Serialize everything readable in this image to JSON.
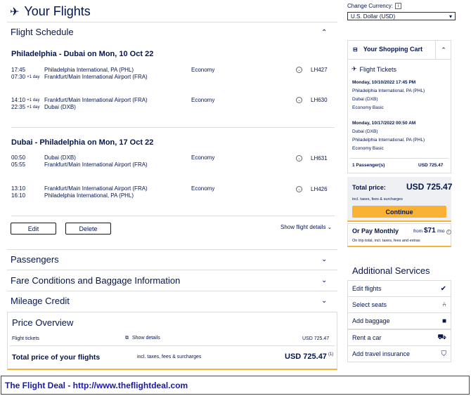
{
  "title": "Your Flights",
  "schedule": {
    "title": "Flight Schedule",
    "outbound": {
      "heading": "Philadelphia - Dubai on Mon, 10 Oct 22",
      "legs": [
        {
          "dep_time": "17:45",
          "arr_time": "07:30",
          "arr_sup": "+1 day",
          "from": "Philadelphia International, PA (PHL)",
          "to": "Frankfurt/Main International Airport (FRA)",
          "class": "Economy",
          "flight": "LH427"
        },
        {
          "dep_time": "14:10",
          "dep_sup": "+1 day",
          "arr_time": "22:35",
          "arr_sup": "+1 day",
          "from": "Frankfurt/Main International Airport (FRA)",
          "to": "Dubai (DXB)",
          "class": "Economy",
          "flight": "LH630"
        }
      ]
    },
    "inbound": {
      "heading": "Dubai - Philadelphia on Mon, 17 Oct 22",
      "legs": [
        {
          "dep_time": "00:50",
          "arr_time": "05:55",
          "from": "Dubai (DXB)",
          "to": "Frankfurt/Main International Airport (FRA)",
          "class": "Economy",
          "flight": "LH631"
        },
        {
          "dep_time": "13:10",
          "arr_time": "16:10",
          "from": "Frankfurt/Main International Airport (FRA)",
          "to": "Philadelphia International, PA (PHL)",
          "class": "Economy",
          "flight": "LH426"
        }
      ]
    },
    "edit_label": "Edit",
    "delete_label": "Delete",
    "show_details_label": "Show flight details"
  },
  "sections": {
    "passengers": "Passengers",
    "fare": "Fare Conditions and Baggage Information",
    "mileage": "Mileage Credit"
  },
  "price_overview": {
    "title": "Price Overview",
    "tickets_label": "Flight tickets",
    "show_details": "Show details",
    "tickets_value": "USD 725.47",
    "total_label": "Total price of your flights",
    "total_note": "incl. taxes, fees & surcharges",
    "total_value": "USD 725.47",
    "total_sup": "(1)"
  },
  "sidebar": {
    "currency_label": "Change Currency:",
    "currency_value": "U.S. Dollar (USD)",
    "cart_title": "Your Shopping Cart",
    "tickets_title": "Flight Tickets",
    "out_date": "Monday, 10/10/2022 17:45 PM",
    "out_from": "Philadelphia International, PA (PHL)",
    "out_to": "Dubai (DXB)",
    "out_fare": "Economy Basic",
    "in_date": "Monday, 10/17/2022 00:50 AM",
    "in_from": "Dubai (DXB)",
    "in_to": "Philadelphia International, PA (PHL)",
    "in_fare": "Economy Basic",
    "passengers": "1 Passenger(s)",
    "passengers_value": "USD 725.47",
    "total_label": "Total price:",
    "total_value": "USD 725.47",
    "total_note": "incl. taxes, fees & surcharges",
    "continue_label": "Continue",
    "monthly_label": "Or Pay Monthly",
    "monthly_from": "from",
    "monthly_value": "$71",
    "monthly_unit": "/mo",
    "monthly_note": "On trip total, incl. taxes, fees and extras",
    "additional_title": "Additional Services",
    "services": [
      "Edit flights",
      "Select seats",
      "Add baggage",
      "Rent a car",
      "Add travel insurance"
    ]
  },
  "footer": "The Flight Deal - http://www.theflightdeal.com"
}
